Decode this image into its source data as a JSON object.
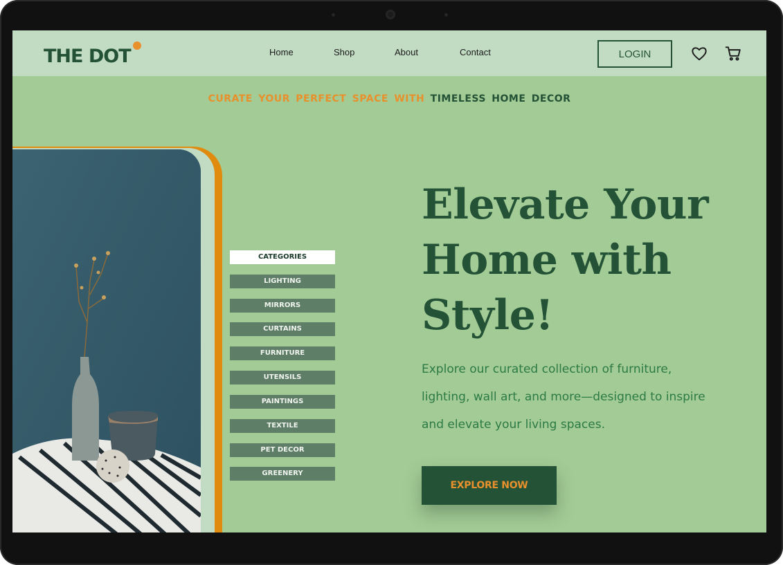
{
  "brand": {
    "logo_text": "THE DOT",
    "colors": {
      "dark_green": "#245237",
      "orange": "#e8902c",
      "page_bg": "#a3cb95",
      "nav_bg": "#c2dcc3"
    }
  },
  "nav": {
    "links": [
      "Home",
      "Shop",
      "About",
      "Contact"
    ],
    "login_label": "LOGIN",
    "icons": [
      "heart-icon",
      "cart-icon"
    ]
  },
  "tagline": {
    "highlight": "CURATE YOUR PERFECT SPACE WITH",
    "rest": "TIMELESS HOME DECOR"
  },
  "categories": {
    "header": "CATEGORIES",
    "items": [
      "LIGHTING",
      "MIRRORS",
      "CURTAINS",
      "FURNITURE",
      "UTENSILS",
      "PAINTINGS",
      "TEXTILE",
      "PET DECOR",
      "GREENERY"
    ]
  },
  "hero": {
    "title_line1": "Elevate Your",
    "title_line2": "Home with",
    "title_line3": "Style!",
    "description": "Explore our curated collection of furniture, lighting, wall art, and more—designed to inspire and elevate your living spaces.",
    "cta_label": "EXPLORE NOW"
  }
}
